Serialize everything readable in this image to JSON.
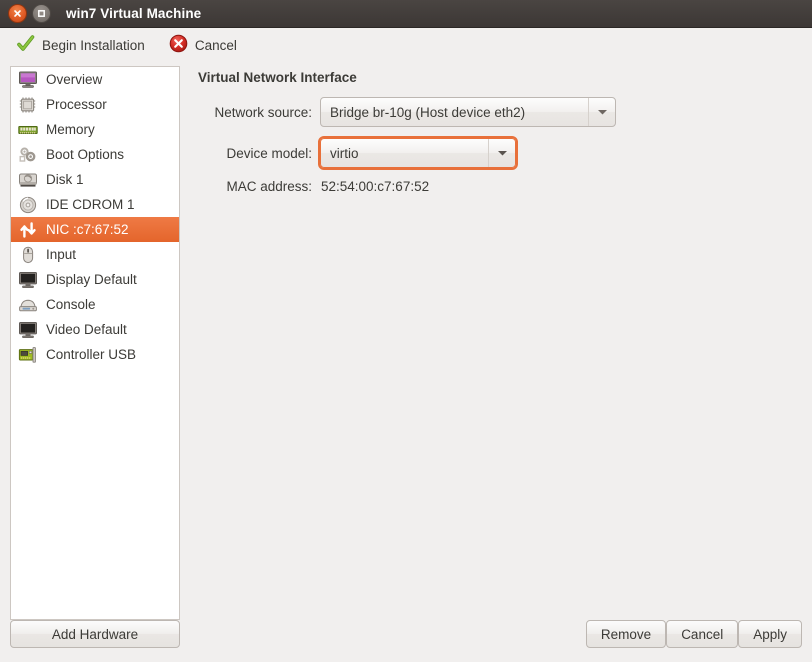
{
  "window": {
    "title": "win7 Virtual Machine",
    "close_icon": "close-icon",
    "maximize_icon": "maximize-icon"
  },
  "toolbar": {
    "begin_installation_label": "Begin Installation",
    "begin_installation_icon": "green-check-icon",
    "cancel_label": "Cancel",
    "cancel_icon": "red-x-circle-icon"
  },
  "sidebar": {
    "items": [
      {
        "label": "Overview",
        "icon": "monitor-overview-icon",
        "selected": false
      },
      {
        "label": "Processor",
        "icon": "cpu-chip-icon",
        "selected": false
      },
      {
        "label": "Memory",
        "icon": "ram-stick-icon",
        "selected": false
      },
      {
        "label": "Boot Options",
        "icon": "gears-icon",
        "selected": false
      },
      {
        "label": "Disk 1",
        "icon": "hard-disk-icon",
        "selected": false
      },
      {
        "label": "IDE CDROM 1",
        "icon": "optical-disc-icon",
        "selected": false
      },
      {
        "label": "NIC :c7:67:52",
        "icon": "network-arrows-icon",
        "selected": true
      },
      {
        "label": "Input",
        "icon": "mouse-icon",
        "selected": false
      },
      {
        "label": "Display Default",
        "icon": "display-icon",
        "selected": false
      },
      {
        "label": "Console",
        "icon": "console-icon",
        "selected": false
      },
      {
        "label": "Video Default",
        "icon": "video-monitor-icon",
        "selected": false
      },
      {
        "label": "Controller USB",
        "icon": "pci-card-icon",
        "selected": false
      }
    ],
    "add_hardware_label": "Add Hardware"
  },
  "main": {
    "title": "Virtual Network Interface",
    "network_source": {
      "label": "Network source:",
      "value": "Bridge br-10g (Host device eth2)",
      "arrow_icon": "chevron-down-icon",
      "focused": false
    },
    "device_model": {
      "label": "Device model:",
      "value": "virtio",
      "arrow_icon": "chevron-down-icon",
      "focused": true
    },
    "mac_address": {
      "label": "MAC address:",
      "value": "52:54:00:c7:67:52"
    }
  },
  "footer": {
    "remove_label": "Remove",
    "cancel_label": "Cancel",
    "apply_label": "Apply"
  },
  "colors": {
    "accent_orange": "#e4652c",
    "titlebar": "#3c3735",
    "background": "#f1efee",
    "list_background": "#ffffff",
    "text": "#3c3b37"
  }
}
